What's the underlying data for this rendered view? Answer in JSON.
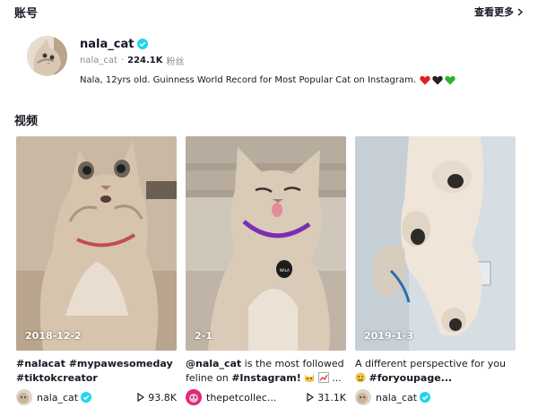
{
  "accounts_section": {
    "title": "账号",
    "see_more": "查看更多"
  },
  "account": {
    "display_name": "nala_cat",
    "username": "nala_cat",
    "followers": "224.1K",
    "followers_label": "粉丝",
    "bio": "Nala, 12yrs old. Guinness World Record for Most Popular Cat on Instagram."
  },
  "videos_section": {
    "title": "视频"
  },
  "videos": [
    {
      "date": "2018-12-2",
      "desc_line1": "#nalacat #mypawesomeday",
      "desc_line2": "#tiktokcreator",
      "author": "nala_cat",
      "plays": "93.8K"
    },
    {
      "date": "2-1",
      "desc_mention": "@nala_cat",
      "desc_part1": " is the most followed",
      "desc_part2": "feline on ",
      "desc_hashtag": "#Instagram!",
      "desc_ellipsis": "...",
      "author": "thepetcollec...",
      "plays": "31.1K"
    },
    {
      "date": "2019-1-3",
      "desc_line1": "A different perspective for you",
      "desc_hashtag": "#foryoupage...",
      "author": "nala_cat",
      "plays": ""
    }
  ],
  "colors": {
    "verified": "#20d5ec",
    "text": "#161823",
    "secondary": "#8a8b91"
  }
}
